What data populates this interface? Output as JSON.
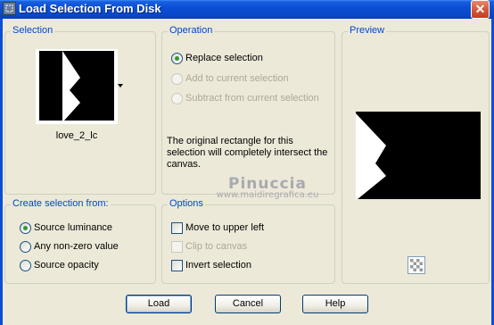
{
  "window": {
    "title": "Load Selection From Disk",
    "close_glyph": "✕"
  },
  "selection_group": {
    "label": "Selection",
    "file_name": "love_2_lc"
  },
  "operation_group": {
    "label": "Operation",
    "options": [
      {
        "label": "Replace selection",
        "checked": true,
        "enabled": true
      },
      {
        "label": "Add to current selection",
        "checked": false,
        "enabled": false
      },
      {
        "label": "Subtract from current selection",
        "checked": false,
        "enabled": false
      }
    ],
    "note": "The original rectangle for this selection will completely intersect the canvas."
  },
  "preview_group": {
    "label": "Preview"
  },
  "create_group": {
    "label": "Create selection from:",
    "options": [
      {
        "label": "Source luminance",
        "checked": true
      },
      {
        "label": "Any non-zero value",
        "checked": false
      },
      {
        "label": "Source opacity",
        "checked": false
      }
    ]
  },
  "options_group": {
    "label": "Options",
    "items": [
      {
        "label": "Move to upper left",
        "checked": false,
        "enabled": true
      },
      {
        "label": "Clip to canvas",
        "checked": false,
        "enabled": false
      },
      {
        "label": "Invert selection",
        "checked": false,
        "enabled": true
      }
    ]
  },
  "watermark": {
    "main": "Pinuccia",
    "sub": "www.maidiregrafica.eu"
  },
  "buttons": {
    "load": "Load",
    "cancel": "Cancel",
    "help": "Help"
  },
  "icons": {
    "app": "selection-app-icon",
    "dropdown": "dropdown-arrow-icon",
    "transparency": "checkerboard-icon"
  },
  "colors": {
    "titlebar": "#0a4fd6",
    "group_label": "#0046d5",
    "dialog_bg": "#ece9d8",
    "radio_dot": "#2f9b2f"
  }
}
